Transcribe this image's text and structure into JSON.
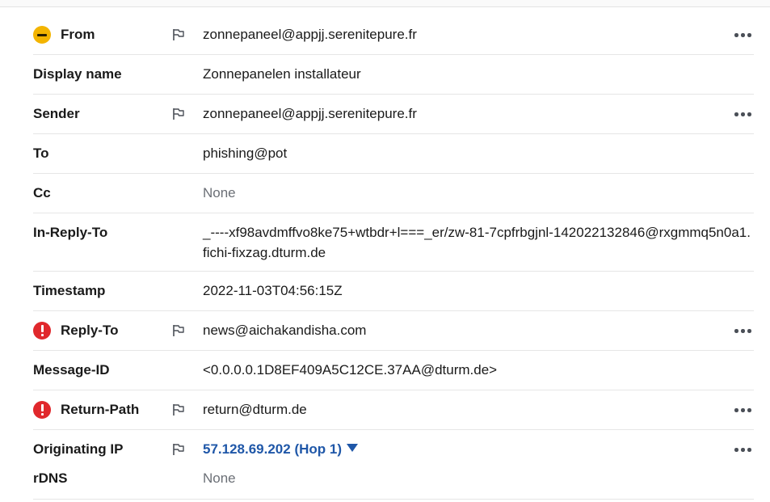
{
  "rows": [
    {
      "label": "From",
      "value": "zonnepaneel@appjj.serenitepure.fr",
      "status": "warning",
      "flag": true,
      "more": true
    },
    {
      "label": "Display name",
      "value": "Zonnepanelen installateur"
    },
    {
      "label": "Sender",
      "value": "zonnepaneel@appjj.serenitepure.fr",
      "flag": true,
      "more": true
    },
    {
      "label": "To",
      "value": "phishing@pot"
    },
    {
      "label": "Cc",
      "value": "None"
    },
    {
      "label": "In-Reply-To",
      "value": "_----xf98avdmffvo8ke75+wtbdr+l===_er/zw-81-7cpfrbgjnl-142022132846@rxgmmq5n0a1.fichi-fixzag.dturm.de"
    },
    {
      "label": "Timestamp",
      "value": "2022-11-03T04:56:15Z"
    },
    {
      "label": "Reply-To",
      "value": "news@aichakandisha.com",
      "status": "error",
      "flag": true,
      "more": true
    },
    {
      "label": "Message-ID",
      "value": "<0.0.0.0.1D8EF409A5C12CE.37AA@dturm.de>"
    },
    {
      "label": "Return-Path",
      "value": "return@dturm.de",
      "status": "error",
      "flag": true,
      "more": true
    },
    {
      "label": "Originating IP",
      "value": "57.128.69.202 (Hop 1)",
      "flag": true,
      "more": true
    },
    {
      "label": "rDNS",
      "value": "None"
    }
  ],
  "icons": {
    "status_warning": "minus-circle-icon",
    "status_error": "exclamation-circle-icon",
    "flag": "flag-icon",
    "more": "more-horizontal-icon",
    "dropdown": "caret-down-icon"
  },
  "colors": {
    "warning": "#f3b400",
    "error": "#e0282c",
    "link": "#1f57a8",
    "muted": "#6b6f76"
  }
}
